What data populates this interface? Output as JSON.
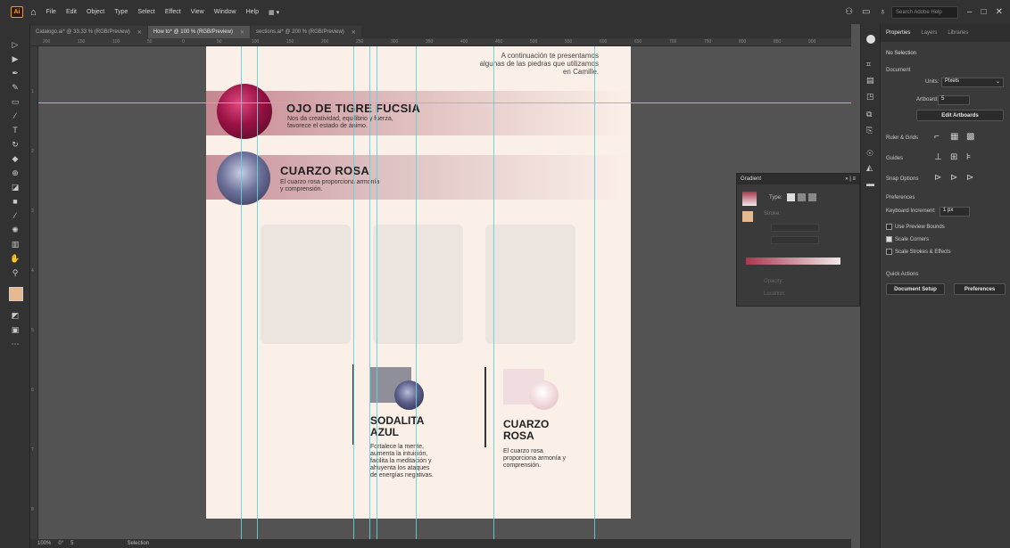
{
  "menubar": {
    "logo": "Ai",
    "items": [
      "File",
      "Edit",
      "Object",
      "Type",
      "Select",
      "Effect",
      "View",
      "Window",
      "Help"
    ],
    "search_placeholder": "Search Adobe Help"
  },
  "tabs": [
    {
      "label": "Catalogo.ai* @ 33.33 % (RGB/Preview)"
    },
    {
      "label": "How to* @ 100 % (RGB/Preview)",
      "active": true
    },
    {
      "label": "sections.ai* @ 200 % (RGB/Preview)"
    }
  ],
  "ruler": {
    "top_ticks": [
      "200",
      "150",
      "100",
      "50",
      "0",
      "50",
      "100",
      "150",
      "200",
      "250",
      "300",
      "350",
      "400",
      "450",
      "500",
      "550",
      "600",
      "650",
      "700",
      "750",
      "800",
      "850",
      "900"
    ],
    "left_ticks": [
      "1",
      "2",
      "3",
      "4",
      "5",
      "6",
      "7",
      "8"
    ]
  },
  "artboard": {
    "intro_line1": "A continuación te presentamos",
    "intro_line2": "algunas de las piedras que utilizamos",
    "intro_line3": "en Camille.",
    "stone1_title": "OJO DE TIGRE FUCSIA",
    "stone1_desc1": "Nos da creatividad, equilibrio y fuerza,",
    "stone1_desc2": "favorece el estado de ánimo.",
    "stone2_title": "CUARZO ROSA",
    "stone2_desc1": "El cuarzo rosa proporciona armonía",
    "stone2_desc2": "y comprensión.",
    "sodalita_title1": "SODALITA",
    "sodalita_title2": "AZUL",
    "sodalita_desc": [
      "Fortalece la mente,",
      "aumenta la intuición,",
      "facilita la meditación y",
      "ahuyenta los ataques",
      "de energías negativas."
    ],
    "cuarzo_title1": "CUARZO",
    "cuarzo_title2": "ROSA",
    "cuarzo_desc": [
      "El cuarzo rosa",
      "proporciona armonía y",
      "comprensión."
    ]
  },
  "gradient_panel": {
    "title": "Gradient",
    "type_label": "Type:",
    "stroke_label": "Stroke:",
    "opacity_label": "Opacity:",
    "location_label": "Location:"
  },
  "properties": {
    "tabs": [
      "Properties",
      "Layers",
      "Libraries"
    ],
    "selection": "No Selection",
    "document_section": "Document",
    "units_label": "Units:",
    "units_value": "Pixels",
    "artboard_label": "Artboard:",
    "artboard_value": "5",
    "edit_artboards": "Edit Artboards",
    "ruler_grids": "Ruler & Grids",
    "guides": "Guides",
    "snap_options": "Snap Options",
    "preferences_section": "Preferences",
    "keyboard_increment_label": "Keyboard Increment:",
    "keyboard_increment_value": "1 px",
    "use_preview_bounds": "Use Preview Bounds",
    "scale_corners": "Scale Corners",
    "scale_strokes": "Scale Strokes & Effects",
    "quick_actions": "Quick Actions",
    "document_setup": "Document Setup",
    "preferences_btn": "Preferences"
  },
  "statusbar": {
    "zoom": "100%",
    "rotate": "0°",
    "artboard_nav": "5",
    "tool": "Selection"
  }
}
